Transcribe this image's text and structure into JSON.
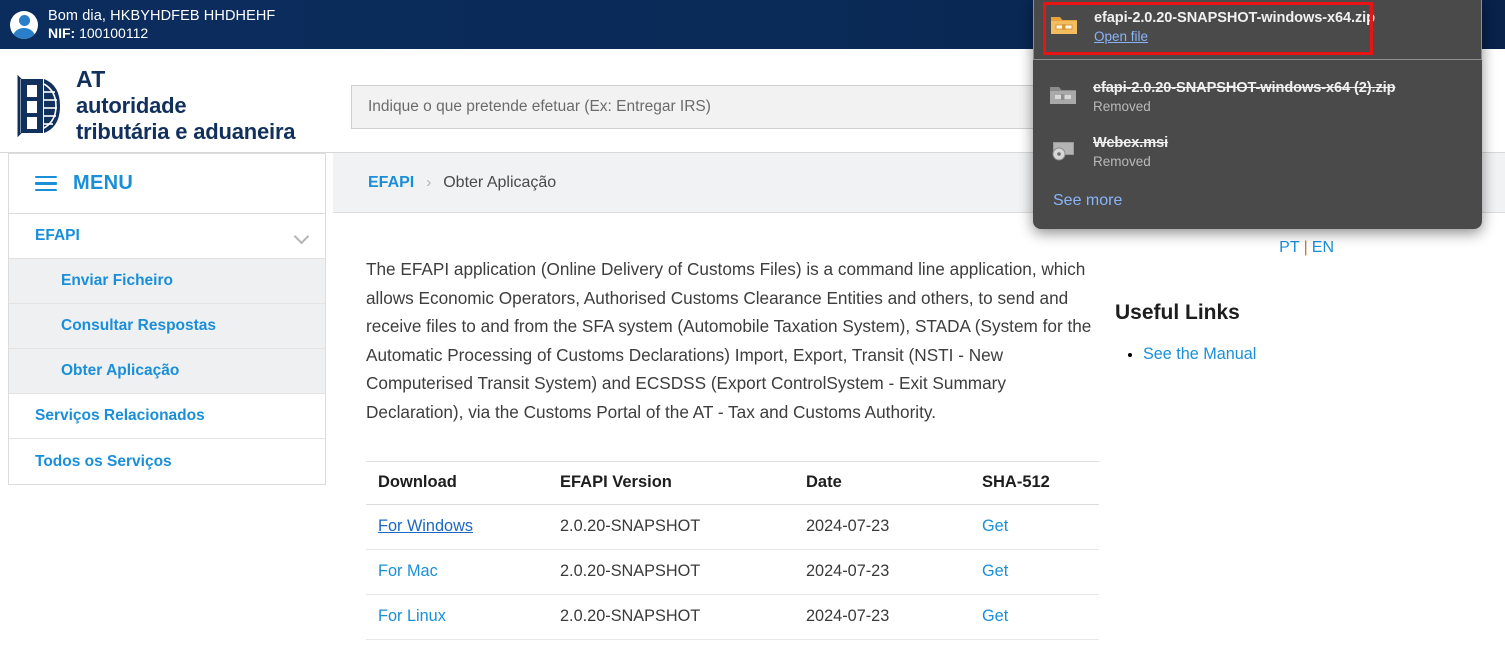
{
  "userbar": {
    "avatar_icon": "user-avatar-icon",
    "greeting": "Bom dia, HKBYHDFEB HHDHEHF",
    "nif_label": "NIF:",
    "nif_value": "100100112"
  },
  "header": {
    "logo_line1": "AT",
    "logo_line2": "autoridade",
    "logo_line3": "tributária e aduaneira",
    "search_placeholder": "Indique o que pretende efetuar (Ex: Entregar IRS)",
    "search_value": ""
  },
  "sidebar": {
    "menu_label": "MENU",
    "menu_icon": "hamburger-icon",
    "items": [
      {
        "label": "EFAPI",
        "level": "top",
        "expanded": true,
        "chevron_icon": "chevron-down-icon"
      },
      {
        "label": "Enviar Ficheiro",
        "level": "sub"
      },
      {
        "label": "Consultar Respostas",
        "level": "sub"
      },
      {
        "label": "Obter Aplicação",
        "level": "sub"
      },
      {
        "label": "Serviços Relacionados",
        "level": "top"
      },
      {
        "label": "Todos os Serviços",
        "level": "top"
      }
    ]
  },
  "breadcrumb": {
    "root": "EFAPI",
    "separator": "›",
    "current": "Obter Aplicação"
  },
  "main": {
    "intro": "The EFAPI application (Online Delivery of Customs Files) is a command line application, which allows Economic Operators, Authorised Customs Clearance Entities and others, to send and receive files to and from the SFA system (Automobile Taxation System), STADA (System for the Automatic Processing of Customs Declarations) Import, Export, Transit (NSTI - New Computerised Transit System) and ECSDSS (Export ControlSystem - Exit Summary Declaration), via the Customs Portal of the AT - Tax and Customs Authority.",
    "table": {
      "headers": [
        "Download",
        "EFAPI Version",
        "Date",
        "SHA-512"
      ],
      "rows": [
        {
          "download": "For Windows",
          "version": "2.0.20-SNAPSHOT",
          "date": "2024-07-23",
          "sha": "Get",
          "visited": true
        },
        {
          "download": "For Mac",
          "version": "2.0.20-SNAPSHOT",
          "date": "2024-07-23",
          "sha": "Get",
          "visited": false
        },
        {
          "download": "For Linux",
          "version": "2.0.20-SNAPSHOT",
          "date": "2024-07-23",
          "sha": "Get",
          "visited": false
        }
      ]
    }
  },
  "aside": {
    "lang_pt": "PT",
    "lang_sep": "|",
    "lang_en": "EN",
    "useful_title": "Useful Links",
    "useful_links": [
      {
        "label": "See the Manual"
      }
    ]
  },
  "download_popup": {
    "items": [
      {
        "name": "efapi-2.0.20-SNAPSHOT-windows-x64.zip",
        "status": "Open file",
        "status_is_link": true,
        "struck": false,
        "icon": "zip-folder-icon",
        "highlighted": true
      },
      {
        "name": "efapi-2.0.20-SNAPSHOT-windows-x64 (2).zip",
        "status": "Removed",
        "status_is_link": false,
        "struck": true,
        "icon": "zip-folder-icon-grey",
        "highlighted": false
      },
      {
        "name": "Webex.msi",
        "status": "Removed",
        "status_is_link": false,
        "struck": true,
        "icon": "installer-disc-icon",
        "highlighted": false
      }
    ],
    "see_more": "See more"
  },
  "colors": {
    "brand_blue": "#1a8fd8",
    "navy": "#0b2d5e",
    "highlight_red": "#e81414",
    "popup_bg": "#4a4a4a",
    "popup_link": "#8ab4f8"
  }
}
